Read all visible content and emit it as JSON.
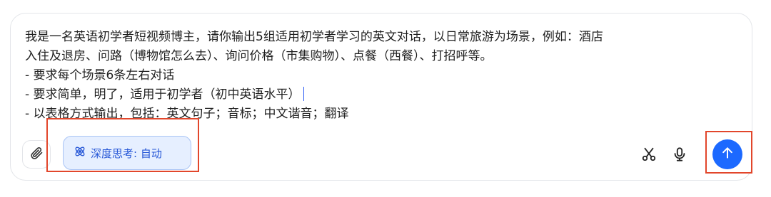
{
  "composer": {
    "lines": [
      "我是一名英语初学者短视频博主，请你输出5组适用初学者学习的英文对话，以日常旅游为场景，例如：酒店",
      "入住及退房、问路（博物馆怎么去）、询问价格（市集购物）、点餐（西餐）、打招呼等。",
      "- 要求每个场景6条左右对话",
      "- 要求简单，明了，适用于初学者（初中英语水平）",
      "- 以表格方式输出，包括：英文句子；音标；中文谐音；翻译"
    ]
  },
  "toolbar": {
    "attach_icon": "paperclip-icon",
    "deep_think_label": "深度思考: 自动",
    "deep_think_icon": "atom-icon",
    "scissors_icon": "scissors-icon",
    "mic_icon": "microphone-icon",
    "send_icon": "arrow-up-icon"
  },
  "colors": {
    "accent": "#1c69ff",
    "deep_think_bg": "#e6efff",
    "deep_think_text": "#2455d6",
    "highlight": "#e2462b"
  }
}
